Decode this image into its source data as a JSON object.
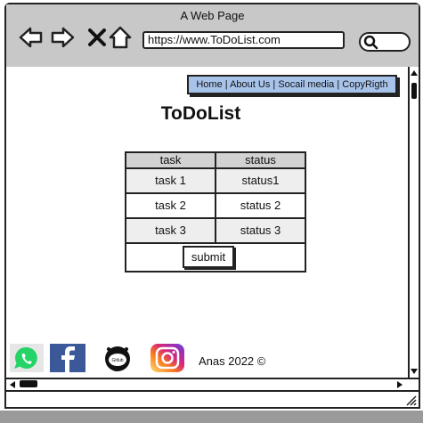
{
  "window": {
    "title": "A Web Page"
  },
  "toolbar": {
    "back_icon": "back-arrow-icon",
    "forward_icon": "forward-arrow-icon",
    "close_icon": "close-icon",
    "home_icon": "home-icon",
    "url": "https://www.ToDoList.com",
    "search_icon": "search-icon"
  },
  "nav": {
    "items": [
      "Home",
      "About Us",
      "Socail media",
      "CopyRigth"
    ],
    "separator": " | ",
    "color": "#a8c3ea"
  },
  "page": {
    "title": "ToDoList"
  },
  "table": {
    "headers": [
      "task",
      "status"
    ],
    "rows": [
      [
        "task 1",
        "status1"
      ],
      [
        "task 2",
        "status 2"
      ],
      [
        "task 3",
        "status 3"
      ]
    ],
    "submit_label": "submit"
  },
  "footer": {
    "social_icons": [
      "whatsapp-icon",
      "facebook-icon",
      "github-icon",
      "instagram-icon"
    ],
    "copyright": "Anas 2022 ©"
  }
}
